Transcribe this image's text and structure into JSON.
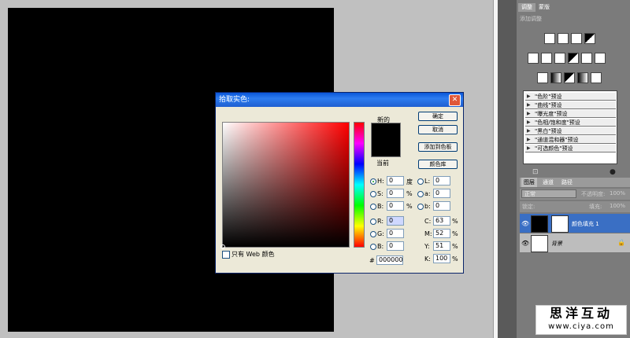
{
  "right_panel": {
    "tabs": [
      "调整",
      "蒙版"
    ],
    "adjust_title": "添加调整",
    "presets": [
      "\"色阶\"预设",
      "\"曲线\"预设",
      "\"曝光度\"预设",
      "\"色相/饱和度\"预设",
      "\"黑白\"预设",
      "\"通道混和器\"预设",
      "\"可选颜色\"预设"
    ],
    "layer_tabs": [
      "图层",
      "通道",
      "路径"
    ],
    "blend_mode": "正常",
    "opacity_label": "不透明度:",
    "opacity_value": "100%",
    "lock_label": "锁定:",
    "fill_label": "填充:",
    "fill_value": "100%",
    "layers": [
      {
        "name": "颜色填充 1",
        "selected": true,
        "thumb_color": "#000000"
      },
      {
        "name": "背景",
        "selected": false,
        "thumb_color": "#ffffff"
      }
    ]
  },
  "dialog": {
    "title": "拾取实色:",
    "label_new": "新的",
    "label_current": "当前",
    "new_color": "#000000",
    "buttons": {
      "ok": "确定",
      "cancel": "取消",
      "add_swatch": "添加到色板",
      "libraries": "颜色库"
    },
    "fields": {
      "H": {
        "label": "H:",
        "value": "0",
        "unit": "度"
      },
      "S": {
        "label": "S:",
        "value": "0",
        "unit": "%"
      },
      "B": {
        "label": "B:",
        "value": "0",
        "unit": "%"
      },
      "R": {
        "label": "R:",
        "value": "0"
      },
      "G": {
        "label": "G:",
        "value": "0"
      },
      "Bl": {
        "label": "B:",
        "value": "0"
      },
      "L": {
        "label": "L:",
        "value": "0"
      },
      "a": {
        "label": "a:",
        "value": "0"
      },
      "b": {
        "label": "b:",
        "value": "0"
      },
      "C": {
        "label": "C:",
        "value": "63",
        "unit": "%"
      },
      "M": {
        "label": "M:",
        "value": "52",
        "unit": "%"
      },
      "Y": {
        "label": "Y:",
        "value": "51",
        "unit": "%"
      },
      "K": {
        "label": "K:",
        "value": "100",
        "unit": "%"
      }
    },
    "web_only_label": "只有 Web 颜色",
    "hex_label": "#",
    "hex_value": "000000"
  },
  "watermark": {
    "line1": "思洋互动",
    "line2": "www.ciya.com"
  }
}
